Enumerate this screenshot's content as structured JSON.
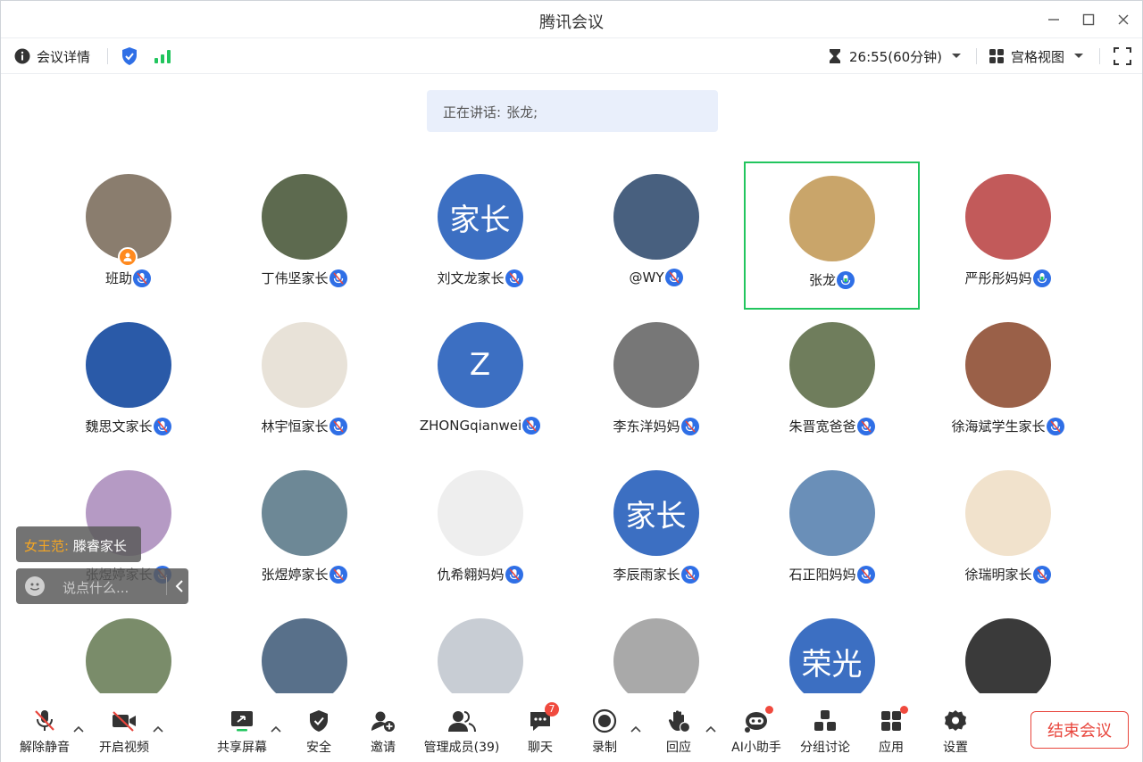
{
  "window": {
    "title": "腾讯会议"
  },
  "infobar": {
    "meeting_details": "会议详情",
    "timer": "26:55(60分钟)",
    "view_mode": "宫格视图"
  },
  "speaking": {
    "label": "正在讲话:",
    "name": "张龙;"
  },
  "participants": [
    {
      "name": "班助",
      "avatar_text": "",
      "avatar_color": "#8a7d6e",
      "host": true,
      "mic": "muted"
    },
    {
      "name": "丁伟坚家长",
      "avatar_text": "",
      "avatar_color": "#5d6a4f",
      "mic": "muted"
    },
    {
      "name": "刘文龙家长",
      "avatar_text": "家长",
      "avatar_color": "#3c6fc2",
      "mic": "muted"
    },
    {
      "name": "@WY",
      "avatar_text": "",
      "avatar_color": "#48607f",
      "mic": "muted"
    },
    {
      "name": "张龙",
      "avatar_text": "",
      "avatar_color": "#c9a56a",
      "mic": "on",
      "active": true
    },
    {
      "name": "严彤彤妈妈",
      "avatar_text": "",
      "avatar_color": "#c25a5a",
      "mic": "on"
    },
    {
      "name": "魏思文家长",
      "avatar_text": "",
      "avatar_color": "#2a5aa8",
      "mic": "muted"
    },
    {
      "name": "林宇恒家长",
      "avatar_text": "",
      "avatar_color": "#e8e2d8",
      "mic": "muted"
    },
    {
      "name": "ZHONGqianwei",
      "avatar_text": "Z",
      "avatar_color": "#3c6fc2",
      "mic": "muted"
    },
    {
      "name": "李东洋妈妈",
      "avatar_text": "",
      "avatar_color": "#777777",
      "mic": "muted"
    },
    {
      "name": "朱晋宽爸爸",
      "avatar_text": "",
      "avatar_color": "#6f7d5c",
      "mic": "muted"
    },
    {
      "name": "徐海斌学生家长",
      "avatar_text": "",
      "avatar_color": "#9a6048",
      "mic": "muted"
    },
    {
      "name": "张煜婷家长",
      "avatar_text": "",
      "avatar_color": "#b59ac4",
      "mic": "muted"
    },
    {
      "name": "张煜婷家长",
      "avatar_text": "",
      "avatar_color": "#6d8896",
      "mic": "muted"
    },
    {
      "name": "仇希翱妈妈",
      "avatar_text": "",
      "avatar_color": "#eeeeee",
      "mic": "muted"
    },
    {
      "name": "李辰雨家长",
      "avatar_text": "家长",
      "avatar_color": "#3c6fc2",
      "mic": "muted"
    },
    {
      "name": "石正阳妈妈",
      "avatar_text": "",
      "avatar_color": "#6a8fb8",
      "mic": "muted"
    },
    {
      "name": "徐瑞明家长",
      "avatar_text": "",
      "avatar_color": "#f1e2cc",
      "mic": "muted"
    },
    {
      "name": "",
      "avatar_text": "",
      "avatar_color": "#7a8c6a"
    },
    {
      "name": "",
      "avatar_text": "",
      "avatar_color": "#58708a"
    },
    {
      "name": "",
      "avatar_text": "",
      "avatar_color": "#c8cdd4"
    },
    {
      "name": "",
      "avatar_text": "",
      "avatar_color": "#a9a9a9"
    },
    {
      "name": "",
      "avatar_text": "荣光",
      "avatar_color": "#3c6fc2"
    },
    {
      "name": "",
      "avatar_text": "",
      "avatar_color": "#3a3a3a"
    }
  ],
  "chat": {
    "last_sender": "女王范:",
    "last_message": "滕睿家长",
    "input_placeholder": "说点什么..."
  },
  "bottombar": {
    "unmute": "解除静音",
    "start_video": "开启视频",
    "share_screen": "共享屏幕",
    "security": "安全",
    "invite": "邀请",
    "manage_members": "管理成员(39)",
    "chat": "聊天",
    "chat_badge": "7",
    "record": "录制",
    "reaction": "回应",
    "ai_assistant": "AI小助手",
    "breakout": "分组讨论",
    "apps": "应用",
    "settings": "设置",
    "end_meeting": "结束会议"
  },
  "colors": {
    "accent": "#2f6fe6",
    "active_border": "#22c55e",
    "end": "#e8453c",
    "host_badge": "#ff8a1f"
  }
}
